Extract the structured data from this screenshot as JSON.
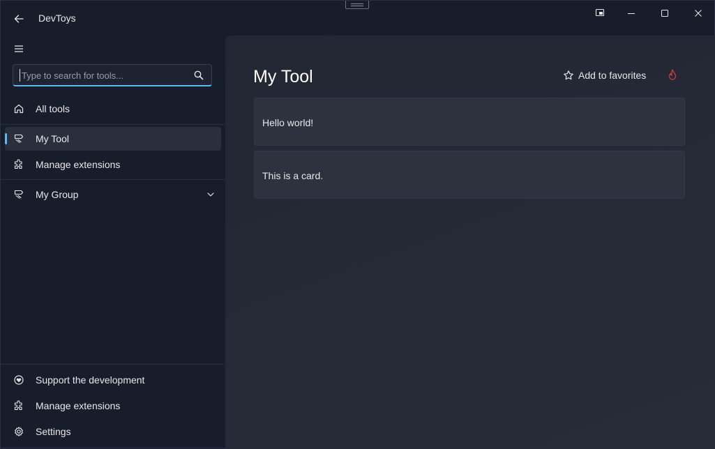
{
  "titlebar": {
    "app_title": "DevToys"
  },
  "sidebar": {
    "search": {
      "placeholder": "Type to search for tools...",
      "value": ""
    },
    "items": [
      {
        "label": "All tools",
        "icon": "home-icon"
      },
      {
        "label": "My Tool",
        "icon": "tool-icon",
        "selected": true
      },
      {
        "label": "Manage extensions",
        "icon": "puzzle-icon"
      },
      {
        "label": "My Group",
        "icon": "tool-icon",
        "expandable": true
      }
    ],
    "footer_items": [
      {
        "label": "Support the development",
        "icon": "heart-icon"
      },
      {
        "label": "Manage extensions",
        "icon": "puzzle-icon"
      },
      {
        "label": "Settings",
        "icon": "gear-icon"
      }
    ]
  },
  "main": {
    "title": "My Tool",
    "favorites_label": "Add to favorites",
    "cards": [
      {
        "text": "Hello world!"
      },
      {
        "text": "This is a card."
      }
    ]
  },
  "colors": {
    "accent": "#60b6f0",
    "flame": "#c8403c",
    "sidebar_bg": "#181d2c",
    "content_bg": "#242834"
  }
}
